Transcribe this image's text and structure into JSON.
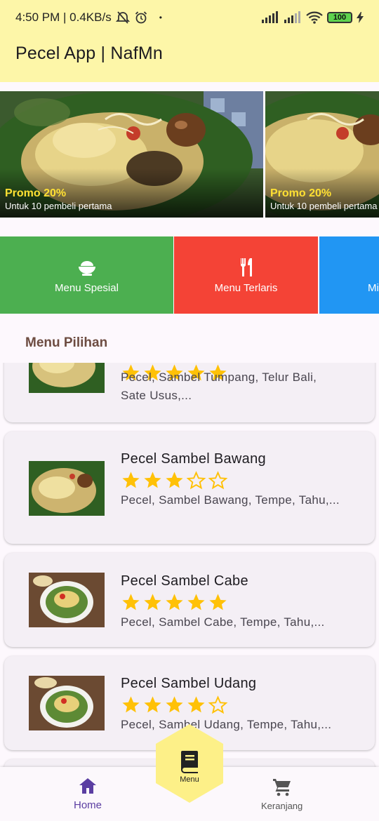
{
  "status_bar": {
    "time_speed": "4:50 PM | 0.4KB/s",
    "dot": "•",
    "battery": "100"
  },
  "app_title": "Pecel App | NafMn",
  "carousel": [
    {
      "promo": "Promo 20%",
      "subtitle": "Untuk 10 pembeli pertama"
    },
    {
      "promo": "Promo 20%",
      "subtitle": "Untuk 10 pembeli pertama"
    }
  ],
  "categories": [
    {
      "label": "Menu Spesial",
      "icon": "rice-bowl-icon",
      "color": "#4caf50"
    },
    {
      "label": "Menu Terlaris",
      "icon": "restaurant-icon",
      "color": "#f44336"
    },
    {
      "label": "Mi",
      "icon": "",
      "color": "#2196f3"
    }
  ],
  "section_title": "Menu Pilihan",
  "menu_items": [
    {
      "name": "",
      "rating": 5,
      "description": "Pecel, Sambel Tumpang, Telur Bali, Sate Usus,..."
    },
    {
      "name": "Pecel Sambel Bawang",
      "rating": 3,
      "description": "Pecel, Sambel Bawang, Tempe, Tahu,..."
    },
    {
      "name": "Pecel Sambel Cabe",
      "rating": 5,
      "description": "Pecel, Sambel Cabe, Tempe, Tahu,..."
    },
    {
      "name": "Pecel Sambel Udang",
      "rating": 4,
      "description": "Pecel, Sambel Udang, Tempe, Tahu,..."
    }
  ],
  "bottom_nav": {
    "home": "Home",
    "menu": "Menu",
    "cart": "Keranjang"
  },
  "colors": {
    "app_bar": "#fdf6a8",
    "star": "#ffc107",
    "accent": "#5b3ea2",
    "section_title": "#6d4c41"
  }
}
